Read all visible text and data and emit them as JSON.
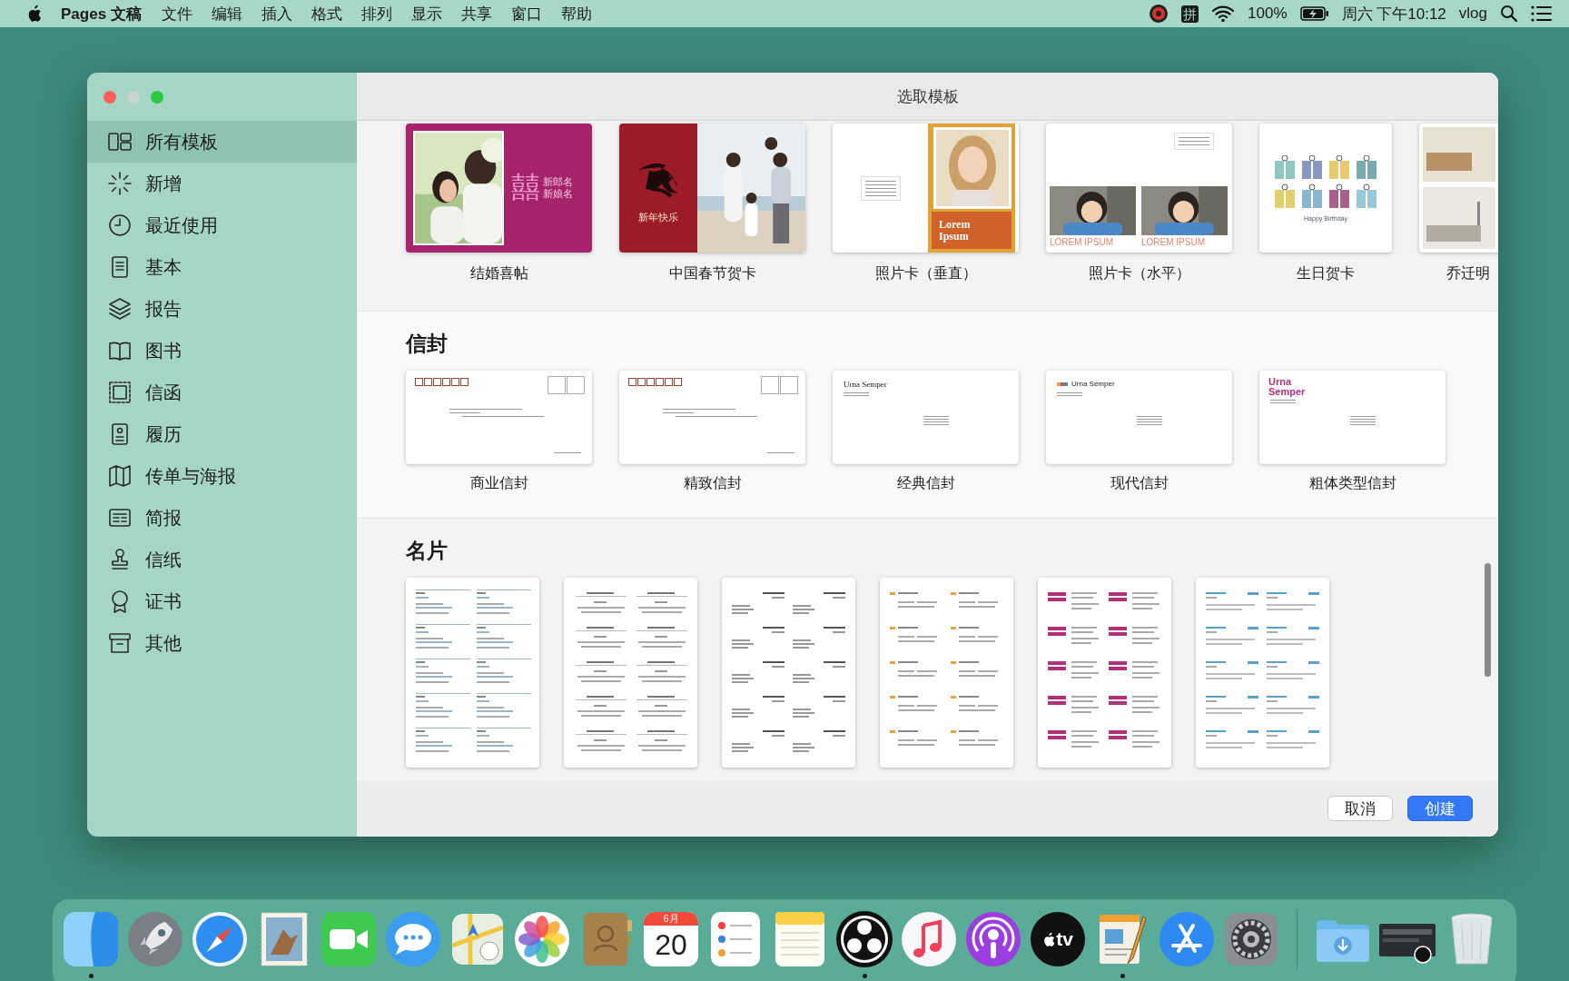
{
  "menu_bar": {
    "app_name": "Pages 文稿",
    "menus": [
      "文件",
      "编辑",
      "插入",
      "格式",
      "排列",
      "显示",
      "共享",
      "窗口",
      "帮助"
    ],
    "input_method": "拼",
    "battery": "100%",
    "clock": "周六 下午10:12",
    "user": "vlog"
  },
  "window": {
    "title": "选取模板"
  },
  "sidebar": {
    "items": [
      {
        "label": "所有模板",
        "kind": "grid",
        "selected": true
      },
      {
        "label": "新增",
        "kind": "sparkle",
        "selected": false
      },
      {
        "label": "最近使用",
        "kind": "clock",
        "selected": false
      },
      {
        "label": "基本",
        "kind": "page",
        "selected": false
      },
      {
        "label": "报告",
        "kind": "layers",
        "selected": false
      },
      {
        "label": "图书",
        "kind": "book",
        "selected": false
      },
      {
        "label": "信函",
        "kind": "frame",
        "selected": false
      },
      {
        "label": "履历",
        "kind": "resume",
        "selected": false
      },
      {
        "label": "传单与海报",
        "kind": "map",
        "selected": false
      },
      {
        "label": "简报",
        "kind": "newsletter",
        "selected": false
      },
      {
        "label": "信纸",
        "kind": "stamp",
        "selected": false
      },
      {
        "label": "证书",
        "kind": "ribbon",
        "selected": false
      },
      {
        "label": "其他",
        "kind": "box",
        "selected": false
      }
    ]
  },
  "sections": [
    {
      "kind": "cards",
      "templates": [
        {
          "name": "结婚喜帖",
          "kind": "wedding",
          "texts": [
            "囍",
            "新郎名",
            "新娘名"
          ]
        },
        {
          "name": "中国春节贺卡",
          "kind": "spring",
          "texts": [
            "新年快乐"
          ]
        },
        {
          "name": "照片卡（垂直）",
          "kind": "photo-vertical",
          "texts": [
            "Lorem",
            "Ipsum"
          ]
        },
        {
          "name": "照片卡（水平）",
          "kind": "photo-horizontal",
          "texts": [
            "LOREM IPSUM",
            "LOREM IPSUM"
          ]
        },
        {
          "name": "生日贺卡",
          "kind": "birthday",
          "texts": [
            "Happy Birthday"
          ]
        },
        {
          "name": "乔迁明",
          "kind": "moving"
        }
      ]
    },
    {
      "kind": "envelopes",
      "heading": "信封",
      "templates": [
        {
          "name": "商业信封",
          "kind": "env-stamp"
        },
        {
          "name": "精致信封",
          "kind": "env-stamp"
        },
        {
          "name": "经典信封",
          "kind": "env-classic",
          "texts": [
            "Urna Semper"
          ]
        },
        {
          "name": "现代信封",
          "kind": "env-modern",
          "texts": [
            "Urna Semper"
          ]
        },
        {
          "name": "粗体类型信封",
          "kind": "env-bold",
          "texts": [
            "Urna",
            "Semper"
          ]
        }
      ]
    },
    {
      "kind": "business-cards",
      "heading": "名片",
      "templates": [
        {
          "kind": "card-basic"
        },
        {
          "kind": "card-fine"
        },
        {
          "kind": "card-classic"
        },
        {
          "kind": "card-modern"
        },
        {
          "kind": "card-bold"
        },
        {
          "kind": "card-informal"
        }
      ]
    }
  ],
  "buttons": [
    {
      "label": "取消",
      "kind": "secondary"
    },
    {
      "label": "创建",
      "kind": "primary"
    }
  ],
  "dock": {
    "apps": [
      {
        "kind": "finder",
        "running": true
      },
      {
        "kind": "launchpad",
        "running": false
      },
      {
        "kind": "safari",
        "running": false
      },
      {
        "kind": "mail",
        "running": false
      },
      {
        "kind": "facetime",
        "running": false
      },
      {
        "kind": "messages",
        "running": false
      },
      {
        "kind": "maps",
        "running": false
      },
      {
        "kind": "photos",
        "running": false
      },
      {
        "kind": "contacts",
        "running": false
      },
      {
        "kind": "calendar",
        "running": false,
        "month": "6月",
        "day": "20"
      },
      {
        "kind": "reminders",
        "running": false
      },
      {
        "kind": "notes",
        "running": false
      },
      {
        "kind": "obs",
        "running": true
      },
      {
        "kind": "music",
        "running": false
      },
      {
        "kind": "podcasts",
        "running": false
      },
      {
        "kind": "tv",
        "running": false,
        "label": "tv"
      },
      {
        "kind": "pages",
        "running": true
      },
      {
        "kind": "appstore",
        "running": false
      },
      {
        "kind": "settings",
        "running": false
      }
    ],
    "others": [
      {
        "kind": "downloads"
      },
      {
        "kind": "screenshot"
      },
      {
        "kind": "trash"
      }
    ]
  }
}
